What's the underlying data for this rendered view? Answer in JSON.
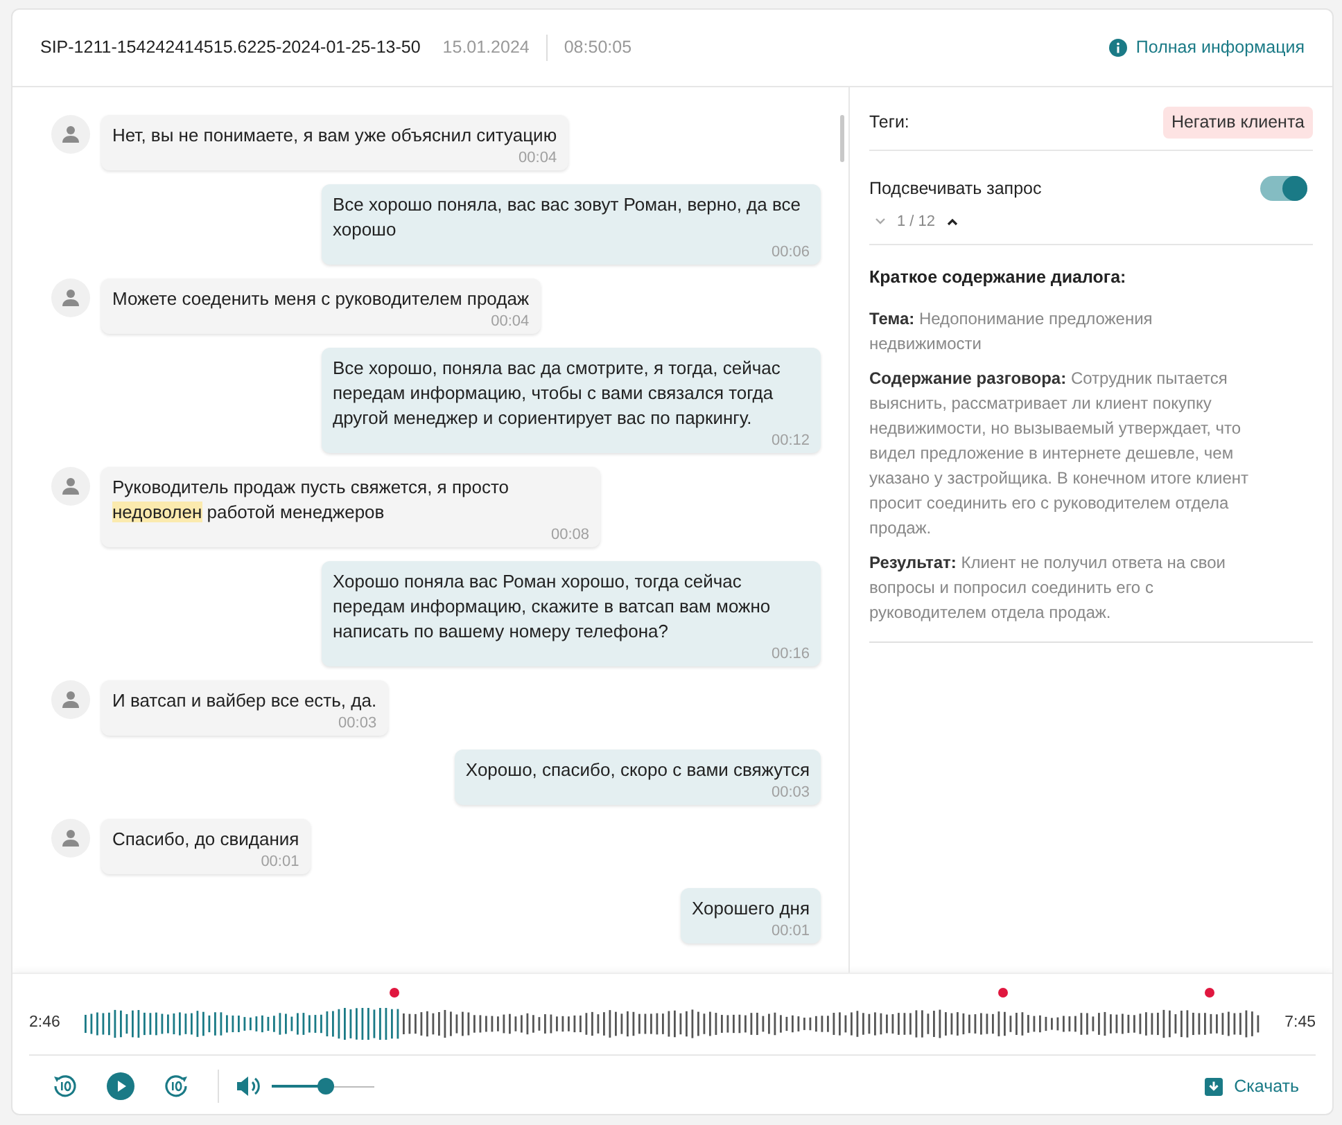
{
  "header": {
    "call_id": "SIP-1211-154242414515.6225-2024-01-25-13-50",
    "date": "15.01.2024",
    "time": "08:50:05",
    "info_link": "Полная информация"
  },
  "messages": [
    {
      "kind": "incoming",
      "segments": [
        {
          "text": "Нет, вы не понимаете, я вам уже объяснил ситуацию",
          "highlighted": false
        }
      ],
      "time": "00:04"
    },
    {
      "kind": "outgoing",
      "segments": [
        {
          "text": "Все хорошо поняла, вас вас зовут Роман, верно, да все хорошо",
          "highlighted": false
        }
      ],
      "time": "00:06"
    },
    {
      "kind": "incoming",
      "segments": [
        {
          "text": "Можете соеденить меня с руководителем продаж",
          "highlighted": false
        }
      ],
      "time": "00:04"
    },
    {
      "kind": "outgoing",
      "segments": [
        {
          "text": "Все хорошо, поняла вас да смотрите, я тогда, сейчас передам информацию, чтобы с вами связался тогда другой менеджер и сориентирует вас по паркингу.",
          "highlighted": false
        }
      ],
      "time": "00:12"
    },
    {
      "kind": "incoming",
      "segments": [
        {
          "text": "Руководитель продаж пусть свяжется, я просто ",
          "highlighted": false
        },
        {
          "text": "недоволен",
          "highlighted": true
        },
        {
          "text": " работой менеджеров",
          "highlighted": false
        }
      ],
      "time": "00:08"
    },
    {
      "kind": "outgoing",
      "segments": [
        {
          "text": "Хорошо поняла вас Роман хорошо, тогда сейчас передам информацию, скажите в ватсап вам можно написать по вашему номеру телефона?",
          "highlighted": false
        }
      ],
      "time": "00:16"
    },
    {
      "kind": "incoming",
      "segments": [
        {
          "text": "И ватсап и вайбер все есть, да.",
          "highlighted": false
        }
      ],
      "time": "00:03"
    },
    {
      "kind": "outgoing",
      "segments": [
        {
          "text": "Хорошо, спасибо, скоро с вами свяжутся",
          "highlighted": false
        }
      ],
      "time": "00:03"
    },
    {
      "kind": "incoming",
      "segments": [
        {
          "text": "Спасибо, до свидания",
          "highlighted": false
        }
      ],
      "time": "00:01"
    },
    {
      "kind": "outgoing",
      "segments": [
        {
          "text": "Хорошего дня",
          "highlighted": false
        }
      ],
      "time": "00:01"
    }
  ],
  "side_panel": {
    "tags_label": "Теги:",
    "tags": [
      "Негатив клиента"
    ],
    "highlight_toggle": {
      "label": "Подсвечивать запрос",
      "on": true
    },
    "match_counter": "1 / 12",
    "summary_title": "Краткое содержание диалога:",
    "summary": [
      {
        "label": "Тема:",
        "text": "Недопонимание предложения недвижимости"
      },
      {
        "label": "Содержание разговора:",
        "text": "Сотрудник пытается выяснить, рассматривает ли клиент покупку недвижимости, но вызываемый утверждает, что видел предложение в интернете дешевле, чем указано у застройщика. В конечном итоге клиент просит соединить его с руководителем отдела продаж."
      },
      {
        "label": "Результат:",
        "text": "Клиент не получил ответа на свои вопросы и попросил соединить его с руководителем отдела продаж."
      }
    ]
  },
  "player": {
    "current_time": "2:46",
    "total_time": "7:45",
    "level": 0.27,
    "volume": {
      "level": 0.53
    },
    "download": "Скачать"
  }
}
